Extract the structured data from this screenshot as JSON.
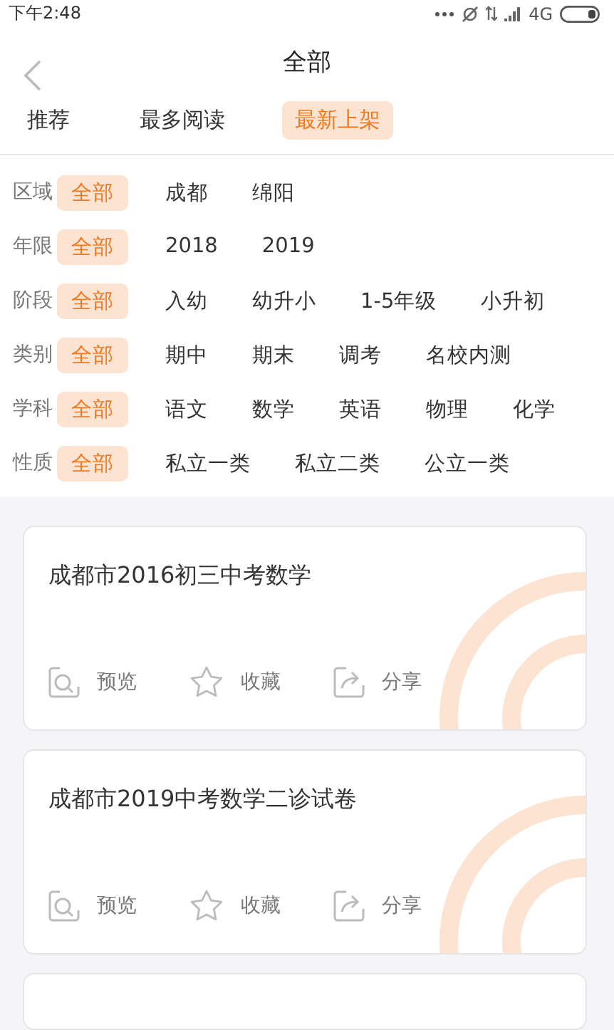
{
  "status_bar": {
    "time": "下午2:48",
    "network": "4G"
  },
  "header": {
    "title": "全部"
  },
  "tabs": [
    {
      "label": "推荐",
      "selected": false
    },
    {
      "label": "最多阅读",
      "selected": false
    },
    {
      "label": "最新上架",
      "selected": true
    }
  ],
  "filters": [
    {
      "label": "区域",
      "options": [
        {
          "label": "全部",
          "selected": true
        },
        {
          "label": "成都",
          "selected": false
        },
        {
          "label": "绵阳",
          "selected": false
        }
      ]
    },
    {
      "label": "年限",
      "options": [
        {
          "label": "全部",
          "selected": true
        },
        {
          "label": "2018",
          "selected": false
        },
        {
          "label": "2019",
          "selected": false
        }
      ]
    },
    {
      "label": "阶段",
      "options": [
        {
          "label": "全部",
          "selected": true
        },
        {
          "label": "入幼",
          "selected": false
        },
        {
          "label": "幼升小",
          "selected": false
        },
        {
          "label": "1-5年级",
          "selected": false
        },
        {
          "label": "小升初",
          "selected": false
        }
      ]
    },
    {
      "label": "类别",
      "options": [
        {
          "label": "全部",
          "selected": true
        },
        {
          "label": "期中",
          "selected": false
        },
        {
          "label": "期末",
          "selected": false
        },
        {
          "label": "调考",
          "selected": false
        },
        {
          "label": "名校内测",
          "selected": false
        }
      ]
    },
    {
      "label": "学科",
      "options": [
        {
          "label": "全部",
          "selected": true
        },
        {
          "label": "语文",
          "selected": false
        },
        {
          "label": "数学",
          "selected": false
        },
        {
          "label": "英语",
          "selected": false
        },
        {
          "label": "物理",
          "selected": false
        },
        {
          "label": "化学",
          "selected": false
        }
      ]
    },
    {
      "label": "性质",
      "options": [
        {
          "label": "全部",
          "selected": true
        },
        {
          "label": "私立一类",
          "selected": false
        },
        {
          "label": "私立二类",
          "selected": false
        },
        {
          "label": "公立一类",
          "selected": false
        }
      ]
    }
  ],
  "cards": [
    {
      "title": "成都市2016初三中考数学",
      "actions": [
        {
          "kind": "preview",
          "label": "预览"
        },
        {
          "kind": "favorite",
          "label": "收藏"
        },
        {
          "kind": "share",
          "label": "分享"
        }
      ]
    },
    {
      "title": "成都市2019中考数学二诊试卷",
      "actions": [
        {
          "kind": "preview",
          "label": "预览"
        },
        {
          "kind": "favorite",
          "label": "收藏"
        },
        {
          "kind": "share",
          "label": "分享"
        }
      ]
    }
  ]
}
